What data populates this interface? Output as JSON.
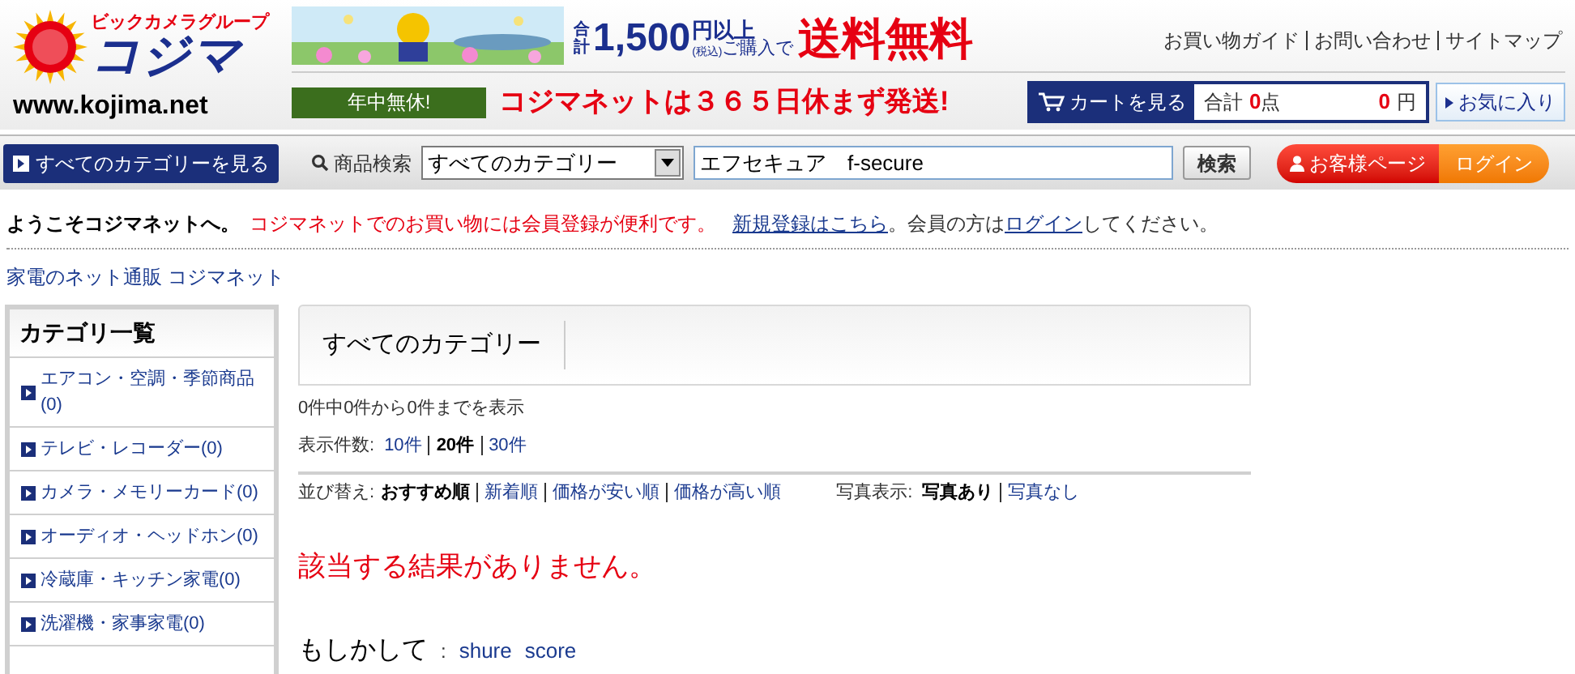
{
  "header": {
    "logo": {
      "group": "ビックカメラグループ",
      "name": "コジマ",
      "url": "www.kojima.net"
    },
    "promo": {
      "total_label": "合計",
      "amount": "1,500",
      "suffix": "円以上",
      "tax_note": "(税込)",
      "purchase": "ご購入で",
      "free_shipping": "送料無料"
    },
    "links": [
      "お買い物ガイド",
      "お問い合わせ",
      "サイトマップ"
    ],
    "open_badge": "年中無休!",
    "shipping_notice": "コジマネットは３６５日休まず発送!",
    "cart": {
      "button": "カートを見る",
      "total_label": "合計",
      "count": "0",
      "count_unit": "点",
      "price": "0",
      "price_unit": "円"
    },
    "favorites": "お気に入り"
  },
  "nav": {
    "all_categories": "すべてのカテゴリーを見る",
    "search_label": "商品検索",
    "category_select": "すべてのカテゴリー",
    "search_value": "エフセキュア　f-secure",
    "search_button": "検索",
    "my_page": "お客様ページ",
    "login": "ログイン"
  },
  "welcome": {
    "greeting": "ようこそコジマネットへ。",
    "notice": "コジマネットでのお買い物には会員登録が便利です。",
    "register_link": "新規登録はこちら",
    "tail_1": "。会員の方は",
    "login_link": "ログイン",
    "tail_2": "してください。"
  },
  "breadcrumb": "家電のネット通販 コジマネット",
  "sidebar": {
    "title": "カテゴリ一覧",
    "items": [
      {
        "label": "エアコン・空調・季節商品(0)"
      },
      {
        "label": "テレビ・レコーダー(0)"
      },
      {
        "label": "カメラ・メモリーカード(0)"
      },
      {
        "label": "オーディオ・ヘッドホン(0)"
      },
      {
        "label": "冷蔵庫・キッチン家電(0)"
      },
      {
        "label": "洗濯機・家事家電(0)"
      }
    ]
  },
  "results": {
    "tab": "すべてのカテゴリー",
    "range": "0件中0件から0件までを表示",
    "per_page_label": "表示件数:",
    "per_page": [
      {
        "label": "10件",
        "selected": false
      },
      {
        "label": "20件",
        "selected": true
      },
      {
        "label": "30件",
        "selected": false
      }
    ],
    "sort_label": "並び替え:",
    "sort": [
      {
        "label": "おすすめ順",
        "selected": true
      },
      {
        "label": "新着順",
        "selected": false
      },
      {
        "label": "価格が安い順",
        "selected": false
      },
      {
        "label": "価格が高い順",
        "selected": false
      }
    ],
    "photo_label": "写真表示:",
    "photo": [
      {
        "label": "写真あり",
        "selected": true
      },
      {
        "label": "写真なし",
        "selected": false
      }
    ],
    "no_results": "該当する結果がありません。",
    "suggest_label": "もしかして",
    "suggest_sep": ":",
    "suggestions": [
      "shure",
      "score"
    ]
  }
}
